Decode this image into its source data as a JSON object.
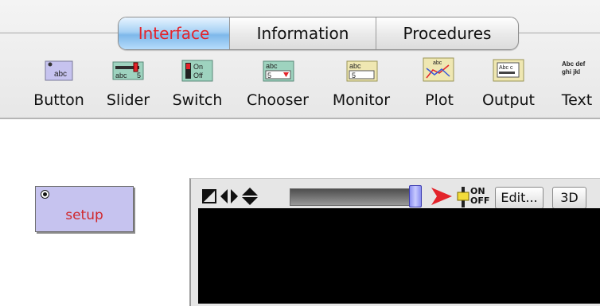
{
  "tabs": [
    {
      "label": "Interface",
      "active": true
    },
    {
      "label": "Information",
      "active": false
    },
    {
      "label": "Procedures",
      "active": false
    }
  ],
  "tools": [
    {
      "label": "Button",
      "icon": "button-tool-icon",
      "icon_text": "abc"
    },
    {
      "label": "Slider",
      "icon": "slider-tool-icon",
      "icon_text": "abc 5"
    },
    {
      "label": "Switch",
      "icon": "switch-tool-icon",
      "icon_text": "On Off"
    },
    {
      "label": "Chooser",
      "icon": "chooser-tool-icon",
      "icon_text": "abc 5"
    },
    {
      "label": "Monitor",
      "icon": "monitor-tool-icon",
      "icon_text": "abc 5"
    },
    {
      "label": "Plot",
      "icon": "plot-tool-icon",
      "icon_text": "abc"
    },
    {
      "label": "Output",
      "icon": "output-tool-icon",
      "icon_text": "Abc c"
    },
    {
      "label": "Text",
      "icon": "text-tool-icon",
      "icon_text": "Abc def ghi jkl"
    }
  ],
  "setup_button": {
    "label": "setup"
  },
  "view_controls": {
    "onoff_label": "ON OFF",
    "edit_label": "Edit...",
    "threed_label": "3D"
  },
  "colors": {
    "accent_red": "#e3242b",
    "button_fill": "#c6c3ef",
    "active_tab": "#7eb8ea"
  }
}
